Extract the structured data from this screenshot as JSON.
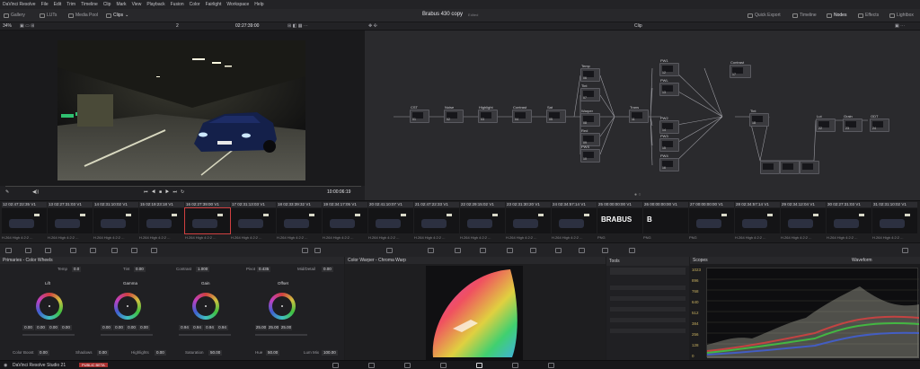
{
  "menu": [
    "DaVinci Resolve",
    "File",
    "Edit",
    "Trim",
    "Timeline",
    "Clip",
    "Mark",
    "View",
    "Playback",
    "Fusion",
    "Color",
    "Fairlight",
    "Workspace",
    "Help"
  ],
  "toolbar": {
    "left": [
      "Gallery",
      "LUTs",
      "Media Pool",
      "Clips"
    ],
    "title": "Brabus 430 copy",
    "subtitle": "Edited",
    "right": [
      "Quick Export",
      "Timeline",
      "Nodes",
      "Effects",
      "Lightbox"
    ]
  },
  "viewer": {
    "zoom": "34%",
    "version": "2",
    "timecode": "02:27:39:00",
    "duration": "10:00:06:19"
  },
  "node_editor": {
    "mode": "Clip",
    "nodes": [
      {
        "label": "CST",
        "num": "01"
      },
      {
        "label": "Noise",
        "num": "02"
      },
      {
        "label": "Highlight",
        "num": "03"
      },
      {
        "label": "Contrast",
        "num": "04"
      },
      {
        "label": "Sat",
        "num": "05"
      },
      {
        "label": "Temp",
        "num": "06"
      },
      {
        "label": "Tint",
        "num": "07"
      },
      {
        "label": "Warper",
        "num": "08"
      },
      {
        "label": "Red",
        "num": "09"
      },
      {
        "label": "PWS",
        "num": "10"
      },
      {
        "label": "Trans",
        "num": "11"
      },
      {
        "label": "PW1",
        "num": "12"
      },
      {
        "label": "PWL",
        "num": "13"
      },
      {
        "label": "PW2",
        "num": "14"
      },
      {
        "label": "PW3",
        "num": "15"
      },
      {
        "label": "PW4",
        "num": "16"
      },
      {
        "label": "Contrast",
        "num": "17"
      },
      {
        "label": "Tint",
        "num": "18"
      },
      {
        "label": "Lut",
        "num": "22"
      },
      {
        "label": "Grain",
        "num": "23"
      },
      {
        "label": "ODT",
        "num": "24"
      }
    ]
  },
  "clips": [
    {
      "num": "12",
      "tc": "02:47:22:35",
      "track": "V1",
      "codec": "H.264 High 4:2:2 ..."
    },
    {
      "num": "13",
      "tc": "02:27:31:03",
      "track": "V1",
      "codec": "H.264 High 4:2:2 ..."
    },
    {
      "num": "14",
      "tc": "02:31:10:02",
      "track": "V1",
      "codec": "H.264 High 4:2:2 ..."
    },
    {
      "num": "15",
      "tc": "02:19:23:18",
      "track": "V1",
      "codec": "H.264 High 4:2:2 ..."
    },
    {
      "num": "16",
      "tc": "02:27:39:00",
      "track": "V1",
      "codec": "H.264 High 4:2:2 ..."
    },
    {
      "num": "17",
      "tc": "02:31:13:03",
      "track": "V1",
      "codec": "H.264 High 4:2:2 ..."
    },
    {
      "num": "18",
      "tc": "02:33:39:32",
      "track": "V1",
      "codec": "H.264 High 4:2:2 ..."
    },
    {
      "num": "19",
      "tc": "02:34:17:05",
      "track": "V1",
      "codec": "H.264 High 4:2:2 ..."
    },
    {
      "num": "20",
      "tc": "02:41:10:07",
      "track": "V1",
      "codec": "H.264 High 4:2:2 ..."
    },
    {
      "num": "21",
      "tc": "02:47:22:33",
      "track": "V1",
      "codec": "H.264 High 4:2:2 ..."
    },
    {
      "num": "22",
      "tc": "02:29:15:02",
      "track": "V1",
      "codec": "H.264 High 4:2:2 ..."
    },
    {
      "num": "23",
      "tc": "02:31:30:20",
      "track": "V1",
      "codec": "H.264 High 4:2:2 ..."
    },
    {
      "num": "24",
      "tc": "02:34:57:14",
      "track": "V1",
      "codec": "H.264 High 4:2:2 ..."
    },
    {
      "num": "25",
      "tc": "00:00:00:00",
      "track": "V1",
      "codec": "PNG",
      "text": "BRABUS"
    },
    {
      "num": "26",
      "tc": "00:00:00:00",
      "track": "V1",
      "codec": "PNG",
      "text": "B"
    },
    {
      "num": "27",
      "tc": "00:00:00:00",
      "track": "V1",
      "codec": "PNG"
    },
    {
      "num": "28",
      "tc": "02:34:57:14",
      "track": "V1",
      "codec": "H.264 High 4:2:2 ..."
    },
    {
      "num": "29",
      "tc": "02:34:12:04",
      "track": "V1",
      "codec": "H.264 High 4:2:2 ..."
    },
    {
      "num": "30",
      "tc": "02:27:31:03",
      "track": "V1",
      "codec": "H.264 High 4:2:2 ..."
    },
    {
      "num": "31",
      "tc": "02:31:10:02",
      "track": "V1",
      "codec": "H.264 High 4:2:2 ..."
    }
  ],
  "primaries": {
    "title": "Primaries - Color Wheels",
    "temp_label": "Temp",
    "temp": "0.0",
    "tint_label": "Tint",
    "tint": "0.00",
    "contrast_label": "Contrast",
    "contrast": "1.000",
    "pivot_label": "Pivot",
    "pivot": "0.435",
    "middetail_label": "Mid/Detail",
    "middetail": "0.00",
    "wheels": [
      {
        "name": "Lift",
        "vals": [
          "0.00",
          "0.00",
          "0.00",
          "0.00"
        ]
      },
      {
        "name": "Gamma",
        "vals": [
          "0.00",
          "0.00",
          "0.00",
          "0.00"
        ]
      },
      {
        "name": "Gain",
        "vals": [
          "0.94",
          "0.94",
          "0.94",
          "0.94"
        ]
      },
      {
        "name": "Offset",
        "vals": [
          "25.00",
          "25.00",
          "25.00"
        ]
      }
    ],
    "colorboost_label": "Color Boost",
    "colorboost": "0.00",
    "shadows_label": "Shadows",
    "shadows": "0.00",
    "highlights_label": "Highlights",
    "highlights": "0.00",
    "saturation_label": "Saturation",
    "saturation": "50.00",
    "hue_label": "Hue",
    "hue": "50.00",
    "lummix_label": "Lum Mix",
    "lummix": "100.00"
  },
  "warper": {
    "title": "Color Warper - Chroma Warp"
  },
  "tools": {
    "title": "Tools"
  },
  "scopes": {
    "title": "Scopes",
    "mode": "Waveform",
    "scale": [
      "1023",
      "896",
      "768",
      "640",
      "512",
      "384",
      "256",
      "128",
      "0"
    ]
  },
  "status": {
    "app": "DaVinci Resolve Studio 21",
    "badge": "PUBLIC BETA"
  },
  "colors": {
    "accent": "#d04040",
    "node_link": "#9a9aa0"
  }
}
